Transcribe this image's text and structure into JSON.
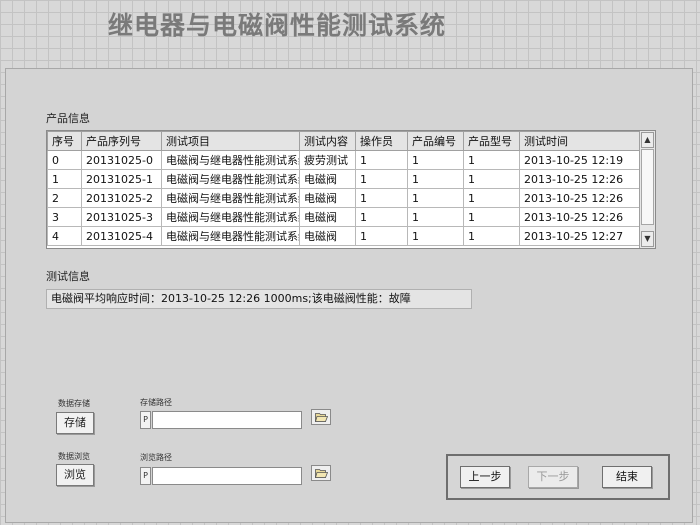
{
  "app": {
    "title": "继电器与电磁阀性能测试系统"
  },
  "product_info": {
    "label": "产品信息",
    "columns": [
      "序号",
      "产品序列号",
      "测试项目",
      "测试内容",
      "操作员",
      "产品编号",
      "产品型号",
      "测试时间"
    ],
    "rows": [
      [
        "0",
        "20131025-0",
        "电磁阀与继电器性能测试系统",
        "疲劳测试",
        "1",
        "1",
        "1",
        "2013-10-25 12:19"
      ],
      [
        "1",
        "20131025-1",
        "电磁阀与继电器性能测试系统",
        "电磁阀",
        "1",
        "1",
        "1",
        "2013-10-25 12:26"
      ],
      [
        "2",
        "20131025-2",
        "电磁阀与继电器性能测试系统",
        "电磁阀",
        "1",
        "1",
        "1",
        "2013-10-25 12:26"
      ],
      [
        "3",
        "20131025-3",
        "电磁阀与继电器性能测试系统",
        "电磁阀",
        "1",
        "1",
        "1",
        "2013-10-25 12:26"
      ],
      [
        "4",
        "20131025-4",
        "电磁阀与继电器性能测试系统",
        "电磁阀",
        "1",
        "1",
        "1",
        "2013-10-25 12:27"
      ]
    ],
    "scroll_up_icon": "triangle-up",
    "scroll_down_icon": "triangle-down"
  },
  "test_info": {
    "label": "测试信息",
    "message": "电磁阀平均响应时间：2013-10-25 12:26 1000ms;该电磁阀性能：故障"
  },
  "storage": {
    "group_label": "数据存储",
    "button_label": "存储",
    "path_label": "存储路径",
    "path_value": "",
    "browse_icon": "folder-open-icon"
  },
  "browse": {
    "group_label": "数据浏览",
    "button_label": "浏览",
    "path_label": "浏览路径",
    "path_value": "",
    "browse_icon": "folder-open-icon"
  },
  "nav": {
    "prev_label": "上一步",
    "next_label": "下一步",
    "next_enabled": false,
    "finish_label": "结束"
  }
}
